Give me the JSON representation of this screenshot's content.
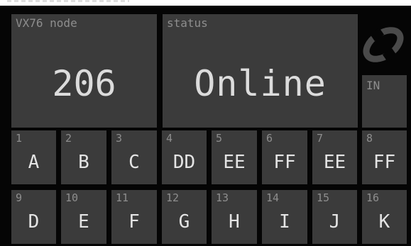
{
  "node": {
    "caption": "VX76 node",
    "value": "206"
  },
  "status": {
    "caption": "status",
    "value": "Online"
  },
  "indicator": {
    "caption": "IN"
  },
  "keys": [
    {
      "num": "1",
      "label": "A"
    },
    {
      "num": "2",
      "label": "B"
    },
    {
      "num": "3",
      "label": "C"
    },
    {
      "num": "4",
      "label": "DD"
    },
    {
      "num": "5",
      "label": "EE"
    },
    {
      "num": "6",
      "label": "FF"
    },
    {
      "num": "7",
      "label": "EE"
    },
    {
      "num": "8",
      "label": "FF"
    },
    {
      "num": "9",
      "label": "D"
    },
    {
      "num": "10",
      "label": "E"
    },
    {
      "num": "11",
      "label": "F"
    },
    {
      "num": "12",
      "label": "G"
    },
    {
      "num": "13",
      "label": "H"
    },
    {
      "num": "14",
      "label": "I"
    },
    {
      "num": "15",
      "label": "J"
    },
    {
      "num": "16",
      "label": "K"
    }
  ],
  "colors": {
    "background": "#050505",
    "tile": "#3b3b3b",
    "caption": "#8e8e8e",
    "text": "#dcdcdc"
  },
  "icons": {
    "logo": "brand-swirl-icon"
  }
}
